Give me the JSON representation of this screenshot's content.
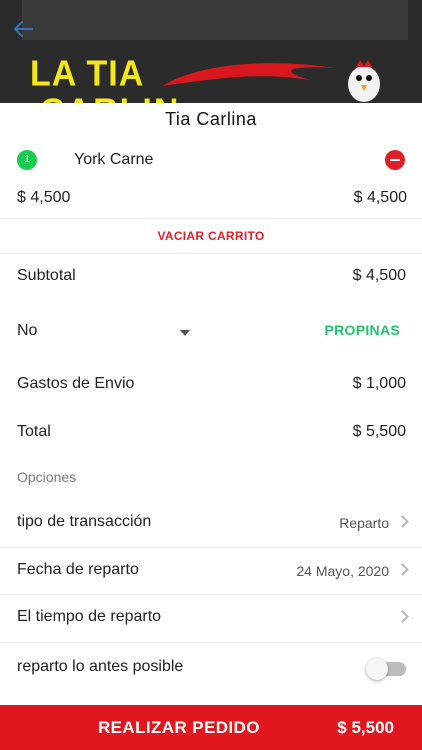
{
  "header": {
    "brand_line1": "LA TIA",
    "brand_line2": "CARLIN"
  },
  "store": {
    "title": "Tia Carlina"
  },
  "cart": {
    "items": [
      {
        "qty": "1",
        "name": "York Carne",
        "unit_price": "$ 4,500",
        "line_total": "$ 4,500"
      }
    ],
    "empty_label": "VACIAR CARRITO"
  },
  "summary": {
    "subtotal_label": "Subtotal",
    "subtotal_value": "$ 4,500",
    "tip_selected": "No",
    "tip_button": "PROPINAS",
    "shipping_label": "Gastos de Envio",
    "shipping_value": "$ 1,000",
    "total_label": "Total",
    "total_value": "$ 5,500"
  },
  "options": {
    "heading": "Opciones",
    "transaction_label": "tipo de transacción",
    "transaction_value": "Reparto",
    "date_label": "Fecha de reparto",
    "date_value": "24 Mayo, 2020",
    "time_label": "El tiempo de reparto",
    "time_value": "",
    "asap_label": "reparto lo antes posible",
    "asap_enabled": false
  },
  "footer": {
    "order_label": "REALIZAR PEDIDO",
    "order_total": "$ 5,500"
  },
  "colors": {
    "accent_red": "#e0171f",
    "tip_green": "#1dc46a",
    "badge_green": "#1ccc4f",
    "brand_yellow": "#f4e816"
  }
}
